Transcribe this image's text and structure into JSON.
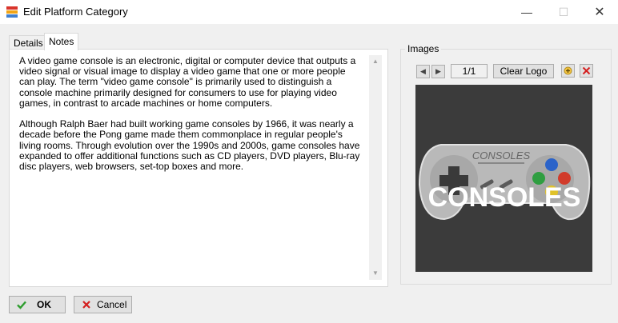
{
  "window": {
    "title": "Edit Platform Category",
    "minimize_icon": "minimize-icon",
    "maximize_icon": "maximize-icon",
    "close_icon": "close-icon"
  },
  "tabs": [
    {
      "label": "Details",
      "active": false
    },
    {
      "label": "Notes",
      "active": true
    }
  ],
  "notes": {
    "text": "A video game console is an electronic, digital or computer device that outputs a video signal or visual image to display a video game that one or more people can play. The term \"video game console\" is primarily used to distinguish a console machine primarily designed for consumers to use for playing video games, in contrast to arcade machines or home computers.\n\nAlthough Ralph Baer had built working game consoles by 1966, it was nearly a decade before the Pong game made them commonplace in regular people's living rooms. Through evolution over the 1990s and 2000s, game consoles have expanded to offer additional functions such as CD players, DVD players, Blu-ray disc players, web browsers, set-top boxes and more."
  },
  "images": {
    "group_label": "Images",
    "page_indicator": "1/1",
    "clear_label": "Clear Logo",
    "logo_text_large": "CONSOLES",
    "logo_text_small": "CONSOLES",
    "prev_icon": "arrow-left-icon",
    "next_icon": "arrow-right-icon",
    "add_icon": "add-image-icon",
    "delete_icon": "delete-image-icon"
  },
  "buttons": {
    "ok_label": "OK",
    "cancel_label": "Cancel"
  },
  "colors": {
    "accent_green": "#2e9d2e",
    "delete_red": "#d42020",
    "image_bg": "#3b3b3b"
  }
}
